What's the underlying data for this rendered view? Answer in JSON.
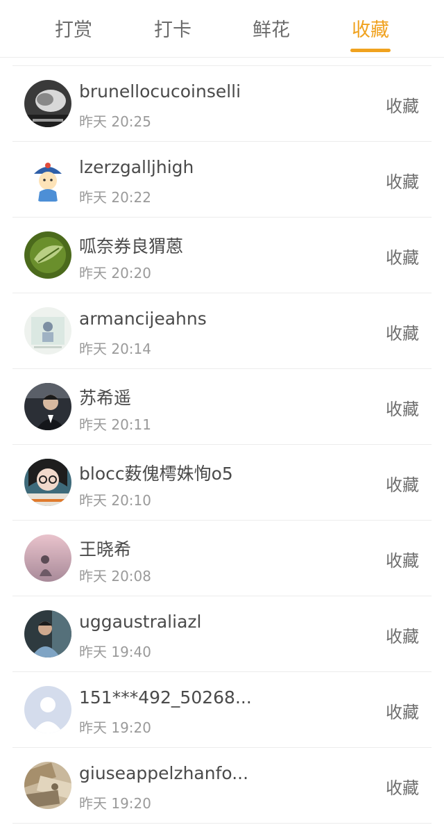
{
  "tabs": [
    {
      "label": "打赏",
      "active": false
    },
    {
      "label": "打卡",
      "active": false
    },
    {
      "label": "鲜花",
      "active": false
    },
    {
      "label": "收藏",
      "active": true
    }
  ],
  "accent_color": "#f0a21f",
  "rows": [
    {
      "name": "brunellocucoinselli",
      "time": "昨天 20:25",
      "action": "收藏",
      "avatar_icon": "grayscale-photo-avatar"
    },
    {
      "name": "lzerzgalljhigh",
      "time": "昨天 20:22",
      "action": "收藏",
      "avatar_icon": "cartoon-character-avatar"
    },
    {
      "name": "呱奈券良猬蒽",
      "time": "昨天 20:20",
      "action": "收藏",
      "avatar_icon": "green-leaf-avatar"
    },
    {
      "name": "armancijeahns",
      "time": "昨天 20:14",
      "action": "收藏",
      "avatar_icon": "light-poster-avatar"
    },
    {
      "name": "苏希遥",
      "time": "昨天 20:11",
      "action": "收藏",
      "avatar_icon": "man-in-suit-avatar"
    },
    {
      "name": "blocc薮傀樗姝恂o5",
      "time": "昨天 20:10",
      "action": "收藏",
      "avatar_icon": "glasses-portrait-avatar"
    },
    {
      "name": "王晓希",
      "time": "昨天 20:08",
      "action": "收藏",
      "avatar_icon": "pink-sky-avatar"
    },
    {
      "name": "uggaustraliazl",
      "time": "昨天 19:40",
      "action": "收藏",
      "avatar_icon": "blue-portrait-avatar"
    },
    {
      "name": "151***492_50268...",
      "time": "昨天 19:20",
      "action": "收藏",
      "avatar_icon": "default-user-avatar"
    },
    {
      "name": "giuseappelzhanfo...",
      "time": "昨天 19:20",
      "action": "收藏",
      "avatar_icon": "banknotes-avatar"
    }
  ]
}
